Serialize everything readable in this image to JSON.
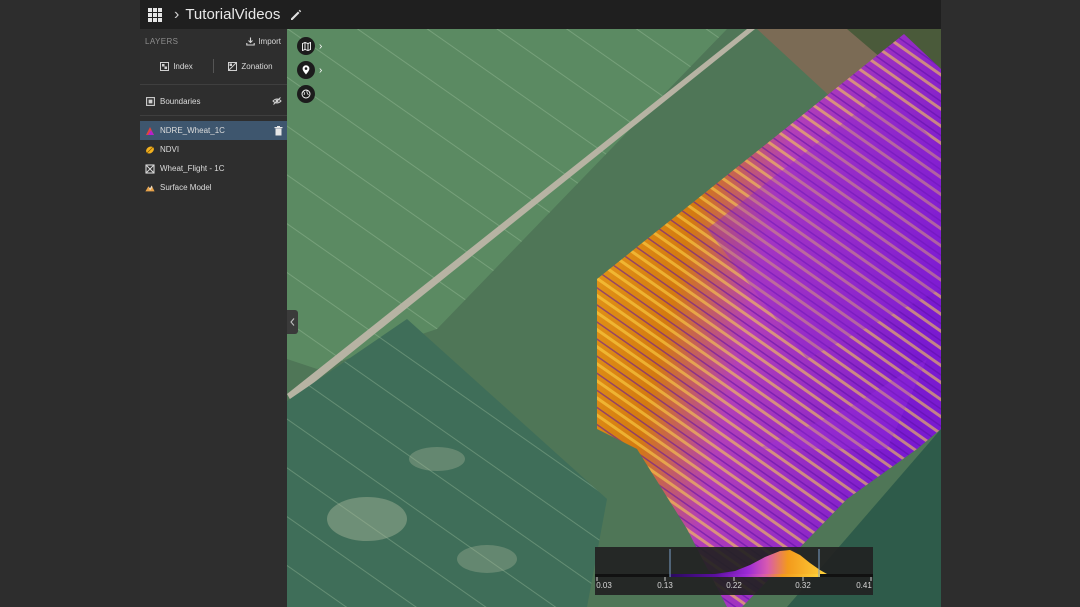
{
  "header": {
    "project_title": "TutorialVideos"
  },
  "sidebar": {
    "section_title": "LAYERS",
    "import_label": "Import",
    "tabs": [
      {
        "label": "Index"
      },
      {
        "label": "Zonation"
      }
    ],
    "boundaries_label": "Boundaries",
    "layers": [
      {
        "label": "NDRE_Wheat_1C",
        "selected": true,
        "icon": "ndre-layer-icon"
      },
      {
        "label": "NDVI",
        "selected": false,
        "icon": "ndvi-layer-icon"
      },
      {
        "label": "Wheat_Flight - 1C",
        "selected": false,
        "icon": "flight-layer-icon"
      },
      {
        "label": "Surface Model",
        "selected": false,
        "icon": "surface-model-icon"
      }
    ]
  },
  "map": {
    "legend": {
      "ticks": [
        "0.03",
        "0.13",
        "0.22",
        "0.32",
        "0.41"
      ],
      "colors": [
        "#2a0a5e",
        "#7b1fd6",
        "#c04cd0",
        "#f39a1c",
        "#ffd23a"
      ]
    }
  },
  "colors": {
    "selected_row": "#3e566e",
    "topbar": "#1f1f1f",
    "sidebar": "#2e2e2e"
  }
}
